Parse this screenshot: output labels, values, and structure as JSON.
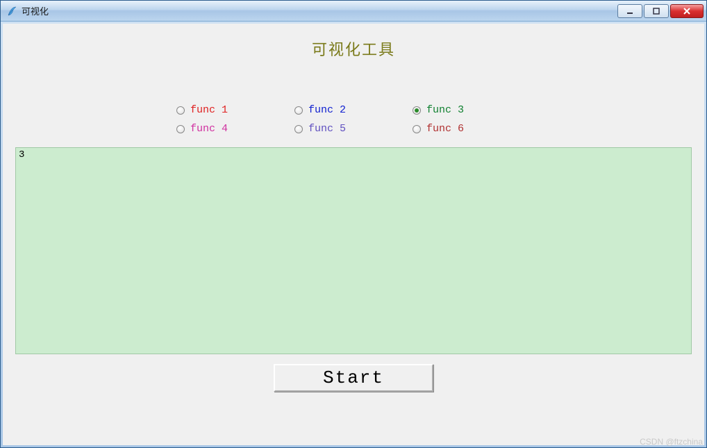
{
  "window": {
    "title": "可视化"
  },
  "heading": "可视化工具",
  "radios": [
    {
      "label": "func 1",
      "color": "c-red",
      "selected": false
    },
    {
      "label": "func 2",
      "color": "c-blue",
      "selected": false
    },
    {
      "label": "func 3",
      "color": "c-green",
      "selected": true
    },
    {
      "label": "func 4",
      "color": "c-magenta",
      "selected": false
    },
    {
      "label": "func 5",
      "color": "c-violet",
      "selected": false
    },
    {
      "label": "func 6",
      "color": "c-brown",
      "selected": false
    }
  ],
  "output": "3",
  "start_label": "Start",
  "watermark": "CSDN @ftzchina",
  "colors": {
    "output_bg": "#cceccf",
    "heading_fg": "#7a7a1a"
  }
}
